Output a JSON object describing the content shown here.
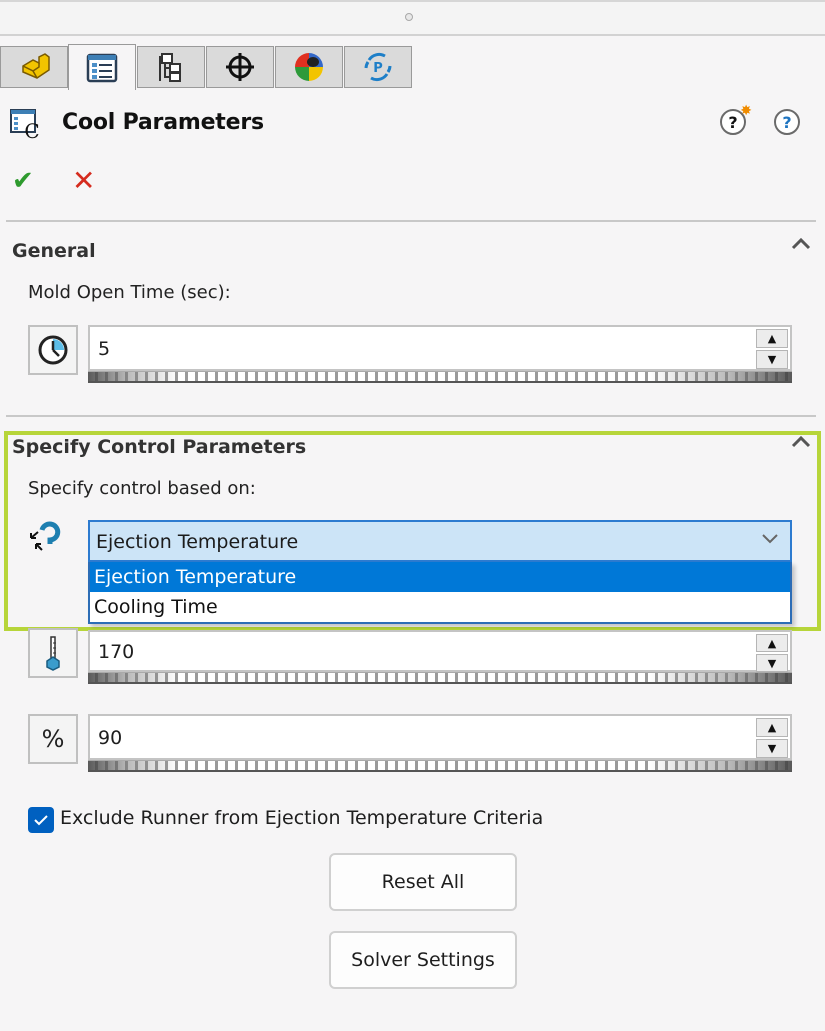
{
  "tabs": [
    {
      "name": "feature-manager",
      "icon": "part-icon",
      "active": false
    },
    {
      "name": "property-manager",
      "icon": "property-list-icon",
      "active": true
    },
    {
      "name": "configuration-manager",
      "icon": "configuration-tree-icon",
      "active": false
    },
    {
      "name": "dimxpert-manager",
      "icon": "crosshair-icon",
      "active": false
    },
    {
      "name": "display-manager",
      "icon": "appearance-ball-icon",
      "active": false
    },
    {
      "name": "plastics-manager",
      "icon": "plastics-cycle-icon",
      "active": false
    }
  ],
  "header": {
    "title": "Cool Parameters",
    "ok_symbol": "✔",
    "cancel_symbol": "✕",
    "help_whats_new": "?",
    "help": "?"
  },
  "general": {
    "heading": "General",
    "collapse_symbol": "^",
    "mold_open_label": "Mold Open Time (sec):",
    "mold_open_value": "5"
  },
  "control": {
    "heading": "Specify Control Parameters",
    "collapse_symbol": "^",
    "based_on_label": "Specify control based on:",
    "selected": "Ejection Temperature",
    "options": [
      "Ejection Temperature",
      "Cooling Time"
    ],
    "highlighted_option": "Ejection Temperature",
    "ejection_temperature_value": "170",
    "percent_value": "90",
    "percent_symbol": "%"
  },
  "exclude_runner": {
    "label": "Exclude Runner from Ejection Temperature Criteria",
    "checked": true
  },
  "buttons": {
    "reset_all": "Reset All",
    "solver_settings": "Solver Settings"
  },
  "colors": {
    "highlight_border": "#b7d53a",
    "selection_blue": "#0078d7",
    "ok_green": "#2e9a2e",
    "cancel_red": "#d52b1e"
  }
}
